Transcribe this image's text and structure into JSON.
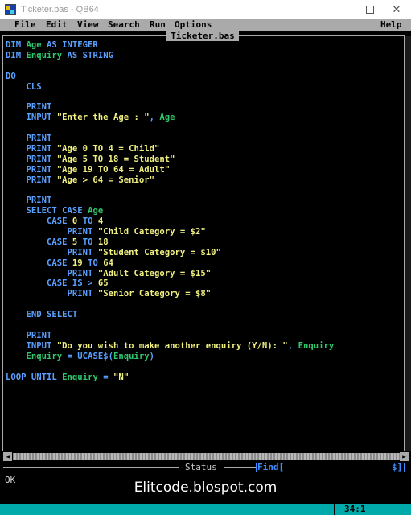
{
  "window": {
    "title": "Ticketer.bas - QB64",
    "minimize_glyph": "—",
    "maximize_glyph": "☐",
    "close_glyph": "✕"
  },
  "menu": {
    "items": [
      "File",
      "Edit",
      "View",
      "Search",
      "Run",
      "Options",
      "Help"
    ]
  },
  "editor": {
    "file_tab": "Ticketer.bas",
    "lines": [
      [
        [
          "kw",
          "DIM "
        ],
        [
          "id",
          "Age"
        ],
        [
          "kw",
          " AS INTEGER"
        ]
      ],
      [
        [
          "kw",
          "DIM "
        ],
        [
          "id",
          "Enquiry"
        ],
        [
          "kw",
          " AS STRING"
        ]
      ],
      [],
      [
        [
          "kw",
          "DO"
        ]
      ],
      [
        [
          "kw",
          "    CLS"
        ]
      ],
      [],
      [
        [
          "kw",
          "    PRINT"
        ]
      ],
      [
        [
          "kw",
          "    INPUT "
        ],
        [
          "str",
          "\"Enter the Age : \""
        ],
        [
          "kw",
          ", "
        ],
        [
          "id",
          "Age"
        ]
      ],
      [],
      [
        [
          "kw",
          "    PRINT"
        ]
      ],
      [
        [
          "kw",
          "    PRINT "
        ],
        [
          "str",
          "\"Age 0 TO 4 = Child\""
        ]
      ],
      [
        [
          "kw",
          "    PRINT "
        ],
        [
          "str",
          "\"Age 5 TO 18 = Student\""
        ]
      ],
      [
        [
          "kw",
          "    PRINT "
        ],
        [
          "str",
          "\"Age 19 TO 64 = Adult\""
        ]
      ],
      [
        [
          "kw",
          "    PRINT "
        ],
        [
          "str",
          "\"Age > 64 = Senior\""
        ]
      ],
      [],
      [
        [
          "kw",
          "    PRINT"
        ]
      ],
      [
        [
          "kw",
          "    SELECT CASE "
        ],
        [
          "id",
          "Age"
        ]
      ],
      [
        [
          "kw",
          "        CASE "
        ],
        [
          "num",
          "0"
        ],
        [
          "kw",
          " TO "
        ],
        [
          "num",
          "4"
        ]
      ],
      [
        [
          "kw",
          "            PRINT "
        ],
        [
          "str",
          "\"Child Category = $2\""
        ]
      ],
      [
        [
          "kw",
          "        CASE "
        ],
        [
          "num",
          "5"
        ],
        [
          "kw",
          " TO "
        ],
        [
          "num",
          "18"
        ]
      ],
      [
        [
          "kw",
          "            PRINT "
        ],
        [
          "str",
          "\"Student Category = $10\""
        ]
      ],
      [
        [
          "kw",
          "        CASE "
        ],
        [
          "num",
          "19"
        ],
        [
          "kw",
          " TO "
        ],
        [
          "num",
          "64"
        ]
      ],
      [
        [
          "kw",
          "            PRINT "
        ],
        [
          "str",
          "\"Adult Category = $15\""
        ]
      ],
      [
        [
          "kw",
          "        CASE IS > "
        ],
        [
          "num",
          "65"
        ]
      ],
      [
        [
          "kw",
          "            PRINT "
        ],
        [
          "str",
          "\"Senior Category = $8\""
        ]
      ],
      [],
      [
        [
          "kw",
          "    END SELECT"
        ]
      ],
      [],
      [
        [
          "kw",
          "    PRINT"
        ]
      ],
      [
        [
          "kw",
          "    INPUT "
        ],
        [
          "str",
          "\"Do you wish to make another enquiry (Y/N): \""
        ],
        [
          "kw",
          ", "
        ],
        [
          "id",
          "Enquiry"
        ]
      ],
      [
        [
          "id",
          "    Enquiry"
        ],
        [
          "kw",
          " = UCASE$("
        ],
        [
          "id",
          "Enquiry"
        ],
        [
          "kw",
          ")"
        ]
      ],
      [],
      [
        [
          "kw",
          "LOOP UNTIL "
        ],
        [
          "id",
          "Enquiry"
        ],
        [
          "kw",
          " = "
        ],
        [
          "str",
          "\"N\""
        ]
      ]
    ]
  },
  "scrollbar": {
    "left_arrow": "◄",
    "right_arrow": "►"
  },
  "status": {
    "label": "Status",
    "find_label": "Find[",
    "find_indicator": "$]"
  },
  "output": {
    "text": "OK"
  },
  "watermark": "Elitcode.blospot.com",
  "cursor_position": "34:1",
  "colors": {
    "keyword": "#5aa0ff",
    "identifier": "#2fc76c",
    "string": "#f0f080",
    "menu_bg": "#aaaaaa",
    "status_bg": "#00aaaa"
  }
}
